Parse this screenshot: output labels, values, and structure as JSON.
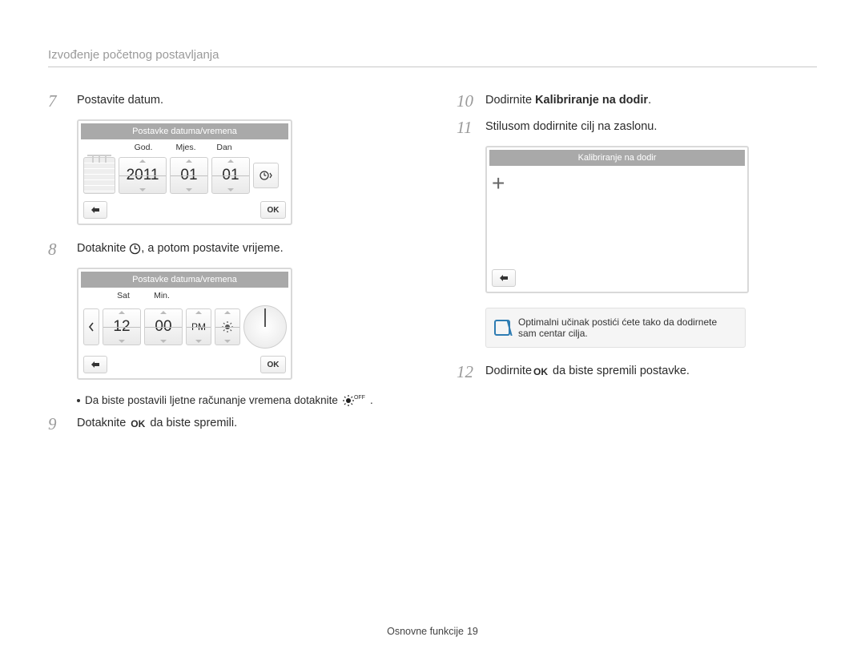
{
  "page_title": "Izvođenje početnog postavljanja",
  "footer_text": "Osnovne funkcije",
  "page_number": "19",
  "left": {
    "s7": {
      "n": "7",
      "t": "Postavite datum."
    },
    "screen1": {
      "title": "Postavke datuma/vremena",
      "labels": {
        "year": "God.",
        "month": "Mjes.",
        "day": "Dan"
      },
      "values": {
        "year": "2011",
        "month": "01",
        "day": "01"
      },
      "ok": "OK"
    },
    "s8": {
      "n": "8",
      "pre": "Dotaknite ",
      "post": ", a potom postavite vrijeme."
    },
    "screen2": {
      "title": "Postavke datuma/vremena",
      "labels": {
        "hour": "Sat",
        "min": "Min."
      },
      "values": {
        "hour": "12",
        "min": "00",
        "ampm": "PM"
      },
      "ok": "OK"
    },
    "bullet_pre": "Da biste postavili ljetne računanje vremena dotaknite ",
    "bullet_sub": "OFF",
    "s9": {
      "n": "9",
      "pre": "Dotaknite ",
      "ok": "OK",
      "post": " da biste spremili."
    }
  },
  "right": {
    "s10": {
      "n": "10",
      "pre": "Dodirnite ",
      "bold": "Kalibriranje na dodir",
      "post": "."
    },
    "s11": {
      "n": "11",
      "t": "Stilusom dodirnite cilj na zaslonu."
    },
    "screen3": {
      "title": "Kalibriranje na dodir"
    },
    "note": "Optimalni učinak postići ćete tako da dodirnete sam centar cilja.",
    "s12": {
      "n": "12",
      "pre": "Dodirnite",
      "ok": "OK",
      "post": " da biste spremili postavke."
    }
  }
}
